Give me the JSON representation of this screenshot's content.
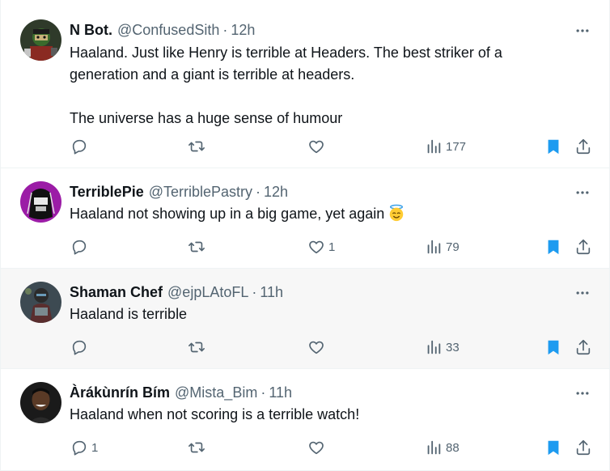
{
  "colors": {
    "text": "#0f1419",
    "secondary": "#536471",
    "bookmark_active": "#1d9bf0",
    "divider": "#eff3f4",
    "hover_bg": "#f7f7f7"
  },
  "tweets": [
    {
      "display_name": "N Bot.",
      "handle": "@ConfusedSith",
      "separator": "·",
      "time": "12h",
      "text": "Haaland. Just like Henry is terrible at Headers. The best striker of a generation and a giant is terrible at headers.\n\nThe universe has a huge sense of humour",
      "reply_count": "",
      "retweet_count": "",
      "like_count": "",
      "views": "177",
      "avatar_icon": "avatar-lego-figure",
      "bookmarked": true
    },
    {
      "display_name": "TerriblePie",
      "handle": "@TerriblePastry",
      "separator": "·",
      "time": "12h",
      "text": "Haaland not showing up in a big game, yet again",
      "emoji": "smiling-face-with-halo",
      "reply_count": "",
      "retweet_count": "",
      "like_count": "1",
      "views": "79",
      "avatar_icon": "avatar-purple-character",
      "bookmarked": true
    },
    {
      "display_name": "Shaman Chef",
      "handle": "@ejpLAtoFL",
      "separator": "·",
      "time": "11h",
      "text": "Haaland is terrible",
      "reply_count": "",
      "retweet_count": "",
      "like_count": "",
      "views": "33",
      "avatar_icon": "avatar-armored-figure",
      "bookmarked": true
    },
    {
      "display_name": "Àrákùnrín Bím",
      "handle": "@Mista_Bim",
      "separator": "·",
      "time": "11h",
      "text": "Haaland when not scoring is a terrible watch!",
      "reply_count": "1",
      "retweet_count": "",
      "like_count": "",
      "views": "88",
      "avatar_icon": "avatar-person-photo",
      "bookmarked": true
    }
  ]
}
